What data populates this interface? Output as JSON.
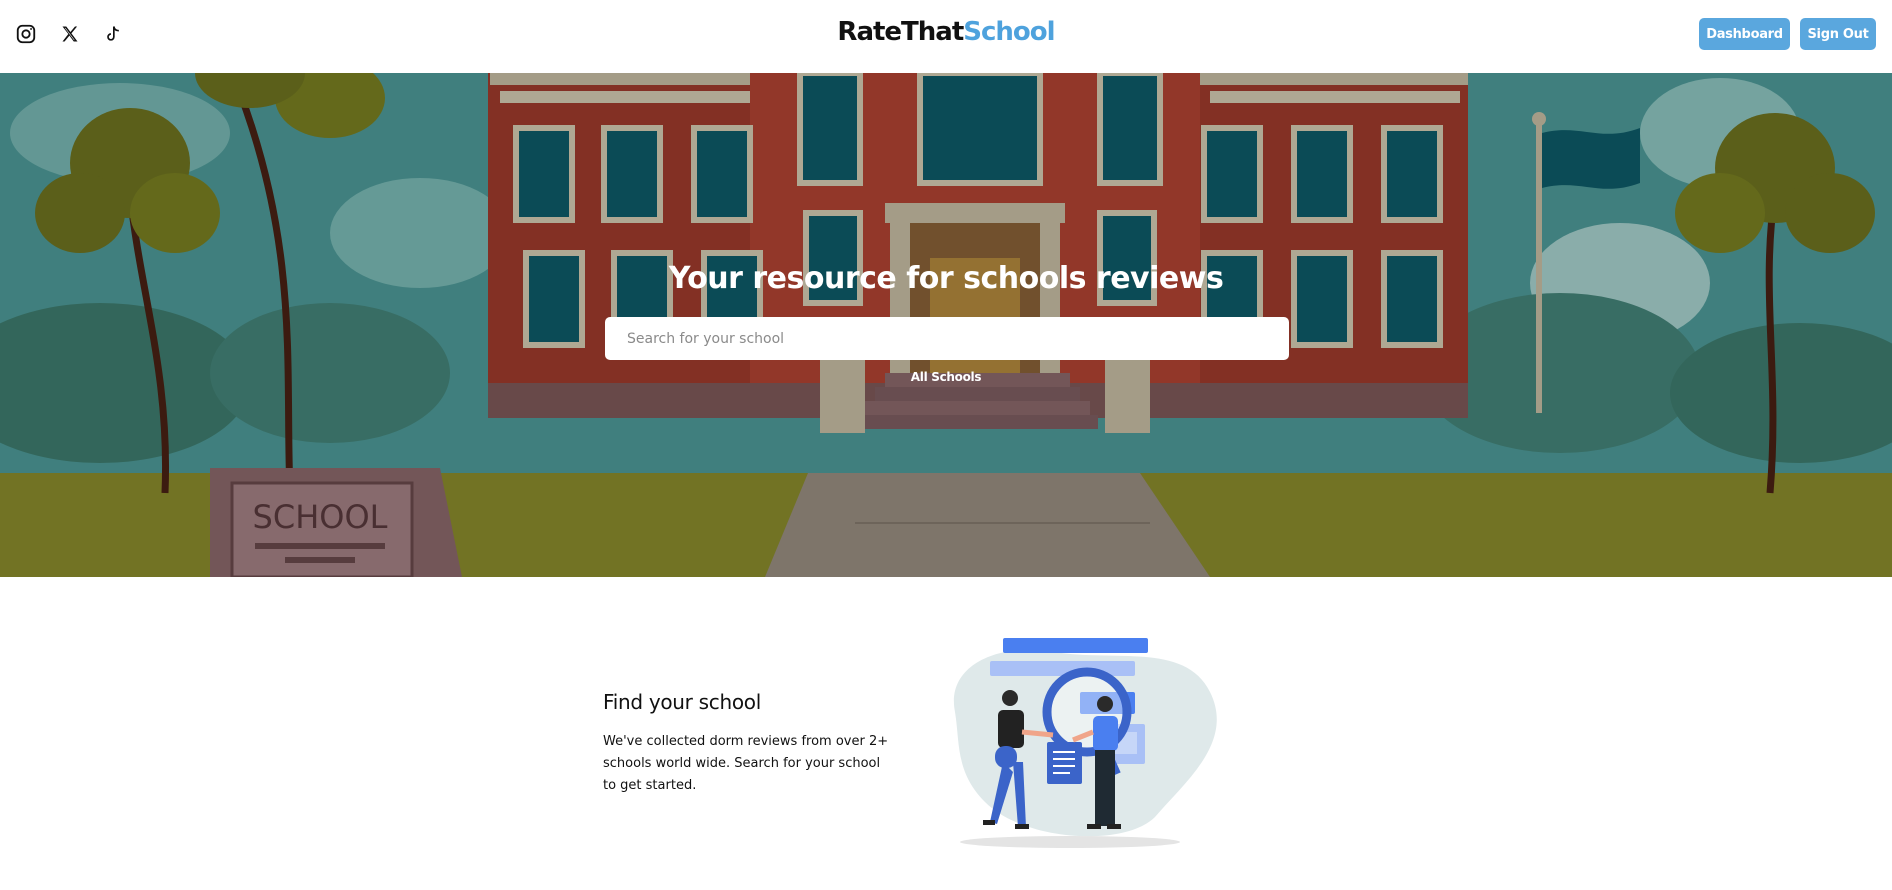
{
  "header": {
    "social_icons": [
      "instagram-icon",
      "x-icon",
      "tiktok-icon"
    ],
    "logo_part1": "RateThat",
    "logo_part2": "School",
    "dashboard_label": "Dashboard",
    "signout_label": "Sign Out"
  },
  "hero": {
    "title": "Your resource for schools reviews",
    "search_placeholder": "Search for your school",
    "all_schools_label": "All Schools",
    "sign_text": "SCHOOL"
  },
  "feature": {
    "title": "Find your school",
    "description": "We've collected dorm reviews from over 2+ schools world wide. Search for your school to get started."
  },
  "colors": {
    "accent": "#5aa7de",
    "logo_blue": "#4ea2dd",
    "brick": "#a03b2c",
    "window": "#0e5c6a"
  }
}
